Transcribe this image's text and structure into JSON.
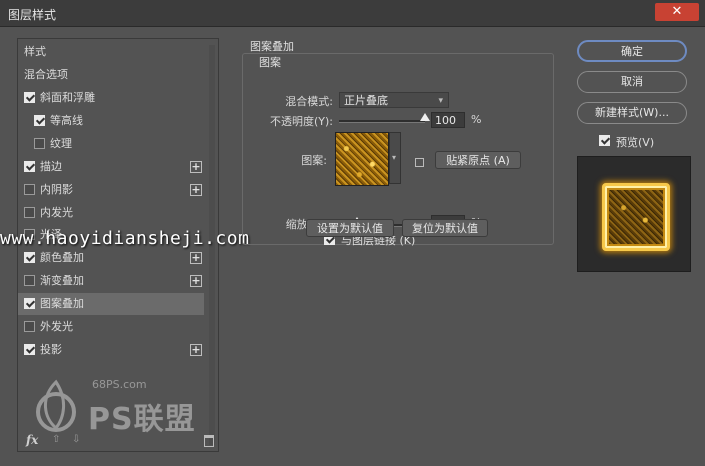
{
  "window": {
    "title": "图层样式",
    "close_glyph": "✕"
  },
  "left_panel": {
    "header_styles": "样式",
    "header_blend": "混合选项",
    "items": [
      {
        "label": "斜面和浮雕",
        "checked": true,
        "plus": false
      },
      {
        "label": "等高线",
        "checked": true,
        "plus": false,
        "indent": true
      },
      {
        "label": "纹理",
        "checked": false,
        "plus": false,
        "indent": true
      },
      {
        "label": "描边",
        "checked": true,
        "plus": true
      },
      {
        "label": "内阴影",
        "checked": false,
        "plus": true
      },
      {
        "label": "内发光",
        "checked": false,
        "plus": false
      },
      {
        "label": "光泽",
        "checked": false,
        "plus": false
      },
      {
        "label": "颜色叠加",
        "checked": true,
        "plus": true
      },
      {
        "label": "渐变叠加",
        "checked": false,
        "plus": true
      },
      {
        "label": "图案叠加",
        "checked": true,
        "plus": false,
        "selected": true
      },
      {
        "label": "外发光",
        "checked": false,
        "plus": false
      },
      {
        "label": "投影",
        "checked": true,
        "plus": true
      }
    ],
    "fx_label": "fx",
    "arrow_up": "⇧",
    "arrow_down": "⇩"
  },
  "pattern_overlay": {
    "group_title": "图案叠加",
    "subgroup_title": "图案",
    "blend_mode_label": "混合模式:",
    "blend_mode_value": "正片叠底",
    "opacity_label": "不透明度(Y):",
    "opacity_value": "100",
    "opacity_fraction": 1.0,
    "pattern_label": "图案:",
    "snap_button": "贴紧原点 (A)",
    "scale_label": "缩放(S):",
    "scale_value": "59",
    "scale_fraction": 0.25,
    "percent": "%",
    "link_label": "与图层链接 (K)",
    "link_checked": true,
    "make_default": "设置为默认值",
    "reset_default": "复位为默认值"
  },
  "right_panel": {
    "ok": "确定",
    "cancel": "取消",
    "new_style": "新建样式(W)...",
    "preview_label": "预览(V)",
    "preview_checked": true
  },
  "watermarks": {
    "url": "www.haoyidiansheji.com",
    "site": "68PS.com",
    "brand": "PS联盟"
  },
  "colors": {
    "dialog_bg": "#535353",
    "titlebar_bg": "#3c3c3c",
    "close_red": "#c84233",
    "primary_outline": "#6e8bc2",
    "gold": "#f6c84a"
  }
}
